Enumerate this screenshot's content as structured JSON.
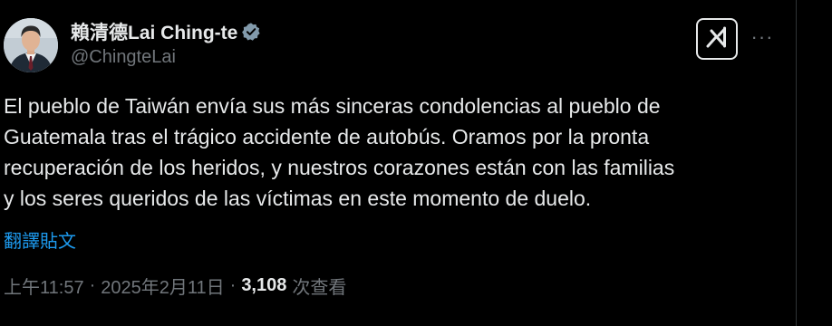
{
  "author": {
    "display_name": "賴清德Lai Ching-te",
    "handle": "@ChingteLai",
    "verified": true
  },
  "header": {
    "grok_icon": "grok-icon",
    "more_icon": "more-icon",
    "more_label": "···"
  },
  "tweet": {
    "lines": [
      "El pueblo de Taiwán envía sus más sinceras condolencias al pueblo de",
      "Guatemala tras el trágico accidente de autobús. Oramos por la pronta",
      "recuperación de los heridos, y nuestros corazones están con las familias",
      "y los seres queridos de las víctimas en este momento de duelo."
    ],
    "translate_label": "翻譯貼文"
  },
  "meta": {
    "time": "上午11:57",
    "separator": "·",
    "date": "2025年2月11日",
    "views_count": "3,108",
    "views_label": "次查看"
  },
  "colors": {
    "background": "#000000",
    "text": "#e7e9ea",
    "secondary": "#71767b",
    "link": "#1d9bf0",
    "verified": "#829aab"
  }
}
